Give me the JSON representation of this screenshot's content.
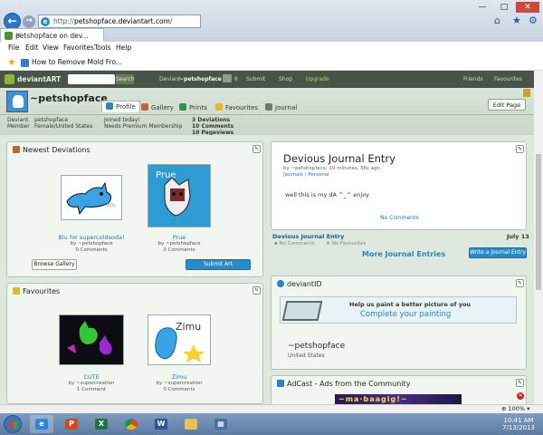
{
  "browser": {
    "url_prefix": "http://",
    "url_domain": "petshopface.deviantart.com",
    "url_suffix": "/",
    "tab_title": "petshopface on dev...",
    "menu": [
      "File",
      "Edit",
      "View",
      "Favorites",
      "Tools",
      "Help"
    ],
    "favorites_link": "How to Remove Mold Fro...",
    "zoom": "100%"
  },
  "da_bar": {
    "brand": "deviantART",
    "search_button": "Search",
    "deviant_label": "Deviant",
    "deviant_name": "~petshopface",
    "messages_count": "6",
    "submit": "Submit",
    "shop": "Shop",
    "upgrade": "Upgrade",
    "friends": "Friends",
    "favourites": "Favourites"
  },
  "profile": {
    "username": "~petshopface",
    "tabs": [
      "Profile",
      "Gallery",
      "Prints",
      "Favourites",
      "Journal"
    ],
    "edit_page": "Edit Page",
    "info": {
      "type_line1": "Deviant",
      "type_line2": "Member",
      "name": "petshopface",
      "gender_loc": "Female/United States",
      "joined": "Joined today!",
      "needs": "Needs Premium Membership",
      "deviations": "3 Deviations",
      "comments": "10 Comments",
      "pageviews": "10 Pageviews"
    }
  },
  "newest": {
    "title": "Newest Deviations",
    "items": [
      {
        "title": "Blu for supercoldsoda!",
        "by": "by ~petshopface",
        "comments": "0 Comments"
      },
      {
        "title": "Prue",
        "by": "by ~petshopface",
        "comments": "0 Comments"
      }
    ],
    "browse_button": "Browse Gallery",
    "submit_button": "Submit Art"
  },
  "favourites": {
    "title": "Favourites",
    "items": [
      {
        "title": "CUTE",
        "by": "by ~supercreation",
        "comments": "1 Comment"
      },
      {
        "title": "Zimu",
        "by": "by ~supercreation",
        "comments": "0 Comments"
      }
    ]
  },
  "journal": {
    "title": "Devious Journal Entry",
    "meta1": "by ~petshopface, 19 minutes, 38s ago",
    "meta2": "Journals / Personal",
    "body": "well this is my dA ^_^ enjoy",
    "no_comments": "No Comments",
    "link": "Devious Journal Entry",
    "date": "July 13",
    "no_comments_small": "No Comments",
    "no_favourites": "No Favourites",
    "more": "More Journal Entries",
    "write_button": "Write a Journal Entry"
  },
  "deviantid": {
    "title": "deviantID",
    "banner_line1": "Help us paint a better picture of you",
    "banner_line2": "Complete your painting",
    "name": "~petshopface",
    "location": "United States"
  },
  "adcast": {
    "title": "AdCast - Ads from the Community",
    "ad_text": "~ma·baagig!~"
  },
  "taskbar": {
    "time": "10:41 AM",
    "date": "7/13/2013"
  }
}
